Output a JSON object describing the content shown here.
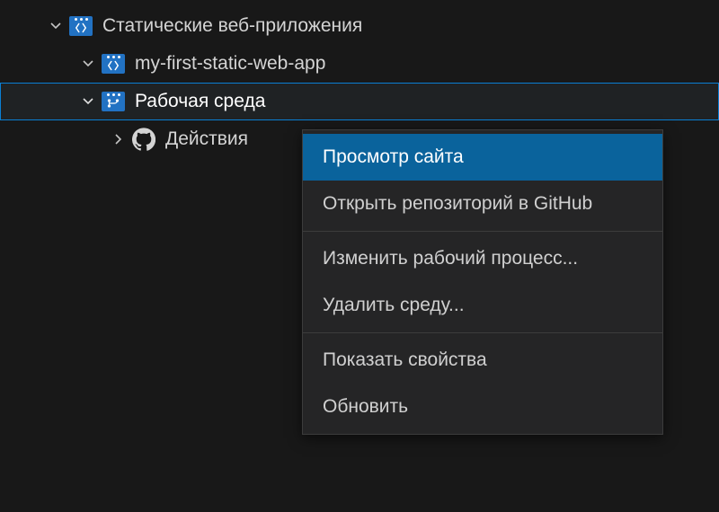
{
  "tree": {
    "root": {
      "label": "Статические веб-приложения"
    },
    "app": {
      "label": "my-first-static-web-app"
    },
    "env": {
      "label": "Рабочая среда"
    },
    "actions": {
      "label": "Действия"
    }
  },
  "context_menu": {
    "items": [
      {
        "label": "Просмотр сайта",
        "hover": true
      },
      {
        "label": "Открыть репозиторий в GitHub"
      }
    ],
    "items2": [
      {
        "label": "Изменить рабочий процесс..."
      },
      {
        "label": "Удалить среду..."
      }
    ],
    "items3": [
      {
        "label": "Показать свойства"
      },
      {
        "label": "Обновить"
      }
    ]
  },
  "colors": {
    "selection_border": "#0a7fd4",
    "menu_hover": "#0a639c",
    "icon_blue": "#2272c3"
  }
}
